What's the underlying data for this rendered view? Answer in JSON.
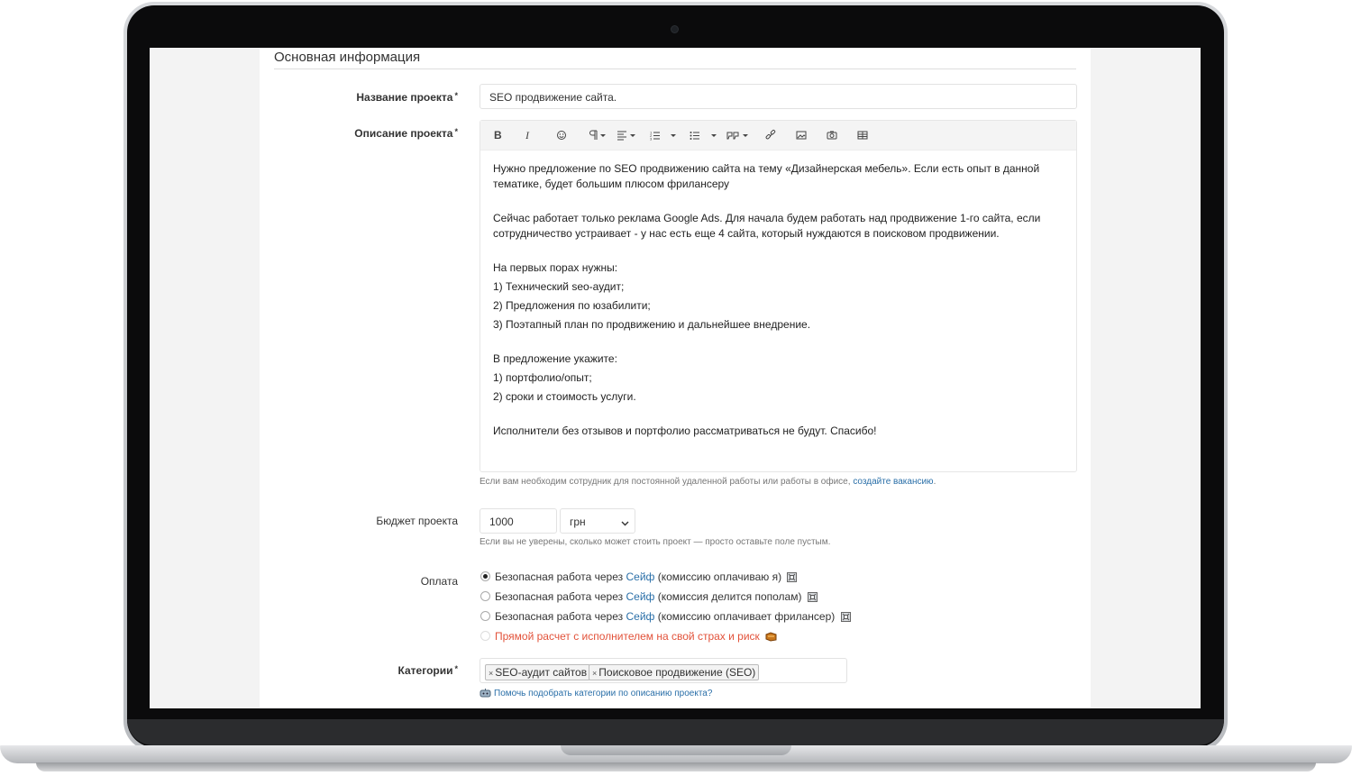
{
  "section": {
    "title": "Основная информация"
  },
  "form": {
    "name_label": "Название проекта",
    "name_value": "SEO продвижение сайта.",
    "desc_label": "Описание проекта",
    "required_mark": "*",
    "toolbar": {
      "bold": "B",
      "italic": "I",
      "icons": [
        "emoji-icon",
        "paragraph-icon",
        "align-icon",
        "ordered-list-icon",
        "unordered-list-icon",
        "quote-icon",
        "link-icon",
        "image-icon",
        "camera-icon",
        "table-icon"
      ]
    },
    "description_lines": [
      "Нужно предложение по SEO продвижению сайта на тему «Дизайнерская мебель». Если есть опыт в данной тематике, будет большим плюсом фрилансеру",
      "",
      "Сейчас работает только реклама Google Ads. Для начала будем работать над продвижение 1-го сайта, если сотрудничество устраивает - у нас есть еще 4 сайта, который нуждаются в поисковом продвижении.",
      "",
      "На первых порах нужны:",
      "1) Технический seo-аудит;",
      "2) Предложения по юзабилити;",
      "3) Поэтапный план по продвижению и дальнейшее внедрение.",
      "",
      "В предложение укажите:",
      "1) портфолио/опыт;",
      "2) сроки и стоимость услуги.",
      "",
      "Исполнители без отзывов и портфолио рассматриваться не будут. Спасибо!"
    ],
    "desc_hint_text": "Если вам необходим сотрудник для постоянной удаленной работы или работы в офисе,",
    "desc_hint_link": "создайте вакансию",
    "desc_hint_end": ".",
    "budget_label": "Бюджет проекта",
    "budget_value": "1000",
    "currency": "грн",
    "budget_hint": "Если вы не уверены, сколько может стоить проект — просто оставьте поле пустым.",
    "payment_label": "Оплата",
    "payment_options": [
      {
        "prefix": "Безопасная работа через ",
        "link": "Сейф",
        "suffix": " (комиссию оплачиваю я)",
        "checked": true
      },
      {
        "prefix": "Безопасная работа через ",
        "link": "Сейф",
        "suffix": " (комиссия делится пополам)",
        "checked": false
      },
      {
        "prefix": "Безопасная работа через ",
        "link": "Сейф",
        "suffix": " (комиссию оплачивает фрилансер)",
        "checked": false
      }
    ],
    "payment_direct": "Прямой расчет с исполнителем на свой страх и риск",
    "categories_label": "Категории",
    "categories": [
      "SEO-аудит сайтов",
      "Поисковое продвижение (SEO)"
    ],
    "category_remove": "×",
    "categories_help": "Помочь подобрать категории по описанию проекта?"
  },
  "colors": {
    "link": "#2a6fa8",
    "danger": "#e2523a"
  }
}
